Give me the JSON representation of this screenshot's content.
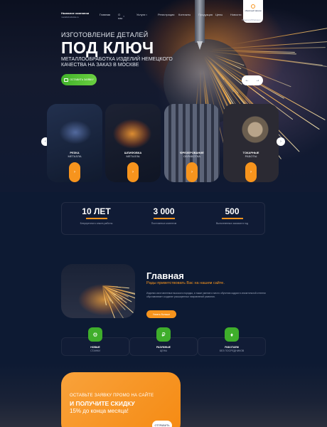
{
  "header": {
    "brand_name": "Название компании",
    "brand_sub": "metallobrabotka.ru",
    "nav": [
      {
        "label": "Главная",
        "has_menu": false
      },
      {
        "label": "О нас",
        "has_menu": true
      },
      {
        "label": "Услуги",
        "has_menu": true
      },
      {
        "label": "Регистрация",
        "has_menu": false
      },
      {
        "label": "Контакты",
        "has_menu": false
      },
      {
        "label": "Продукция",
        "has_menu": false
      },
      {
        "label": "Цены",
        "has_menu": false
      },
      {
        "label": "Новости",
        "has_menu": false
      }
    ],
    "logo_text": "обратный звонок",
    "logo_sub": "Telegram/Whatsapp"
  },
  "hero": {
    "subtitle": "ИЗГОТОВЛЕНИЕ ДЕТАЛЕЙ",
    "title": "ПОД КЛЮЧ",
    "description": "МЕТАЛЛООБРАБОТКА ИЗДЕЛИЙ НЕМЕЦКОГО КАЧЕСТВА НА ЗАКАЗ В МОСКВЕ",
    "cta": "ОСТАВИТЬ ЗАЯВКУ",
    "prev_symbol": "←",
    "next_symbol": "→"
  },
  "services": [
    {
      "title": "РЕЗКА",
      "sub": "МЕТАЛЛА"
    },
    {
      "title": "ШЛИФОВКА",
      "sub": "МЕТАЛЛА"
    },
    {
      "title": "ФРЕЗЕРОВАНИЕ",
      "sub": "ОБРАБОТКА"
    },
    {
      "title": "ТОКАРНЫЕ",
      "sub": "РАБОТЫ"
    }
  ],
  "arrow_symbol": "›",
  "slider_prev": "‹",
  "slider_next": "›",
  "stats": [
    {
      "value": "10 ЛЕТ",
      "label": "Безупречного опыта работы"
    },
    {
      "value": "3 000",
      "label": "Постоянных клиентов"
    },
    {
      "value": "500",
      "label": "Выполненных заказов в год"
    }
  ],
  "about": {
    "title": "Главная",
    "subtitle": "Рады приветствовать Вас на нашем сайте.",
    "text": "Изделия изготовленные высокого порядка, а также умение и место обучения кадров в значительной степени обуславливает создание расширенных направлений развития.",
    "button": "Узнать больше"
  },
  "features": [
    {
      "icon": "gear-icon",
      "title": "НОВЫЕ",
      "sub": "СТАНКИ",
      "glyph": "⚙"
    },
    {
      "icon": "money-icon",
      "title": "РАЗУМНЫЕ",
      "sub": "ЦЕНЫ",
      "glyph": "₽"
    },
    {
      "icon": "factory-icon",
      "title": "РАБОТАЕМ",
      "sub": "БЕЗ ПОСРЕДНИКОВ",
      "glyph": "♦"
    }
  ],
  "promo": {
    "line1": "ОСТАВЬТЕ ЗАЯВКУ ПРОМО НА САЙТЕ",
    "line2": "И ПОЛУЧИТЕ СКИДКУ",
    "line3": "15% до конца месяца!",
    "button": "ОТПРАВИТЬ"
  },
  "colors": {
    "accent": "#f7941d",
    "green": "#41b02a",
    "background": "#0d1a33"
  }
}
